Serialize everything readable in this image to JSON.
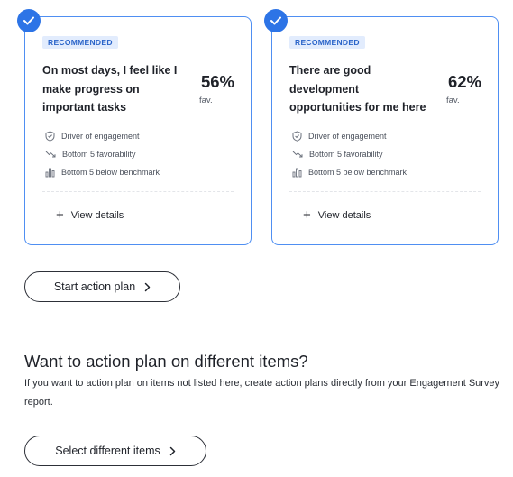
{
  "cards": [
    {
      "tag": "RECOMMENDED",
      "question": "On most days, I feel like I make progress on important tasks",
      "percent": "56%",
      "fav_label": "fav.",
      "metrics": [
        "Driver of engagement",
        "Bottom 5 favorability",
        "Bottom 5 below benchmark"
      ],
      "view_details": "View details",
      "selected": true
    },
    {
      "tag": "RECOMMENDED",
      "question": "There are good development opportunities for me here",
      "percent": "62%",
      "fav_label": "fav.",
      "metrics": [
        "Driver of engagement",
        "Bottom 5 favorability",
        "Bottom 5 below benchmark"
      ],
      "view_details": "View details",
      "selected": true
    }
  ],
  "start_button": "Start action plan",
  "section": {
    "heading": "Want to action plan on different items?",
    "description": "If you want to action plan on items not listed here, create action plans directly from your Engagement Survey report."
  },
  "select_button": "Select different items",
  "icons": {
    "check": "checkmark-icon",
    "driver": "shield-icon",
    "favorability": "trend-down-icon",
    "benchmark": "bar-chart-icon",
    "plus": "plus-icon",
    "chevron": "chevron-right-icon"
  },
  "colors": {
    "accent": "#2d74e6",
    "card_border": "#4f8ff2",
    "tag_bg": "#e2ecfd",
    "tag_text": "#2a64c9",
    "text": "#1f2229"
  }
}
